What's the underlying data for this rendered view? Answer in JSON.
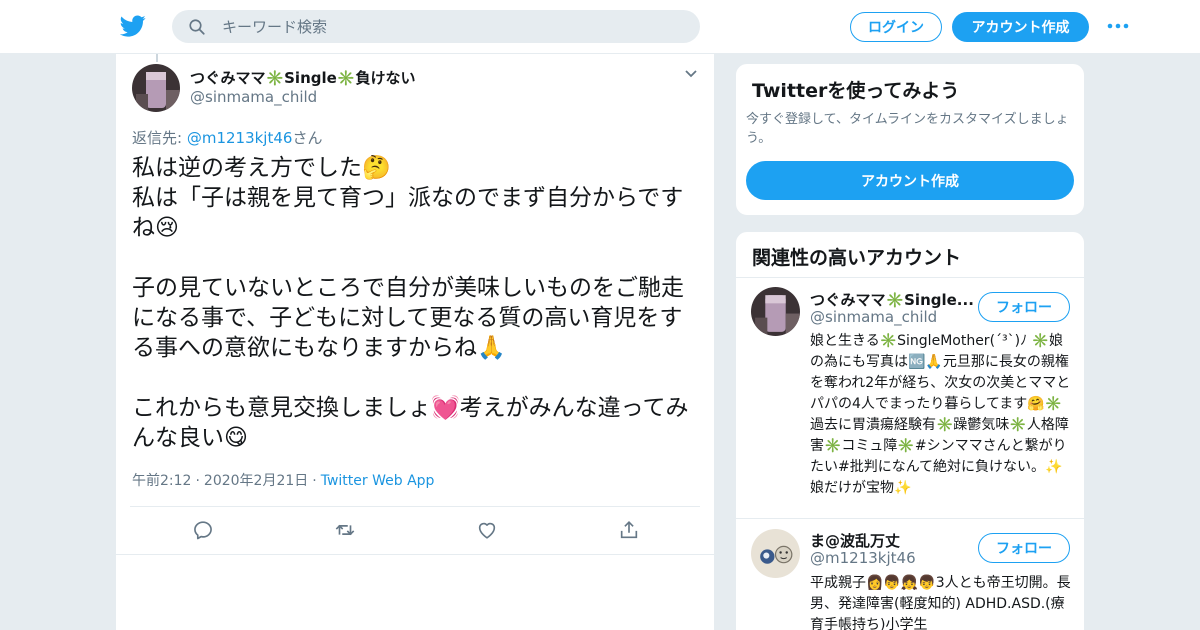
{
  "header": {
    "search_placeholder": "キーワード検索",
    "login_label": "ログイン",
    "signup_label": "アカウント作成"
  },
  "tweet": {
    "author_name": "つぐみママ✳️Single✳️負けない",
    "author_handle": "@sinmama_child",
    "reply_prefix": "返信先: ",
    "reply_handle": "@m1213kjt46",
    "reply_suffix": "さん",
    "text": "私は逆の考え方でした🤔\n私は「子は親を見て育つ」派なのでまず自分からですね😢\n\n子の見ていないところで自分が美味しいものをご馳走になる事で、子どもに対して更なる質の高い育児をする事への意欲にもなりますからね🙏\n\nこれからも意見交換しましょ💓考えがみんな違ってみんな良い😋",
    "time": "午前2:12",
    "date": "2020年2月21日",
    "source": "Twitter Web App",
    "separator": "·"
  },
  "sidebar": {
    "try_card": {
      "title": "Twitterを使ってみよう",
      "description": "今すぐ登録して、タイムラインをカスタマイズしましょう。",
      "button_label": "アカウント作成"
    },
    "related": {
      "title": "関連性の高いアカウント",
      "follow_label": "フォロー",
      "accounts": [
        {
          "name": "つぐみママ✳️Single...",
          "handle": "@sinmama_child",
          "bio": "娘と生きる✳️SingleMother(´³`)ﾉ ✳️娘の為にも写真は🆖🙏元旦那に長女の親権を奪われ2年が経ち、次女の次美とママとパパの4人でまったり暮らしてます🤗✳️過去に胃潰瘍経験有✳️躁鬱気味✳️人格障害✳️コミュ障✳️#シンママさんと繋がりたい#批判になんて絶対に負けない。✨娘だけが宝物✨"
        },
        {
          "name": "ま@波乱万丈",
          "handle": "@m1213kjt46",
          "bio": "平成親子👩👦👧👦3人とも帝王切開。長男、発達障害(軽度知的) ADHD.ASD.(療育手帳持ち)小学生"
        }
      ]
    }
  },
  "colors": {
    "brand_blue": "#1da1f2",
    "link_blue": "#1b95e0",
    "secondary_text": "#657786",
    "background": "#e6ecf0"
  },
  "icons": [
    "twitter-bird-icon",
    "search-icon",
    "more-dots-icon",
    "chevron-down-icon",
    "reply-icon",
    "retweet-icon",
    "like-icon",
    "share-icon"
  ]
}
